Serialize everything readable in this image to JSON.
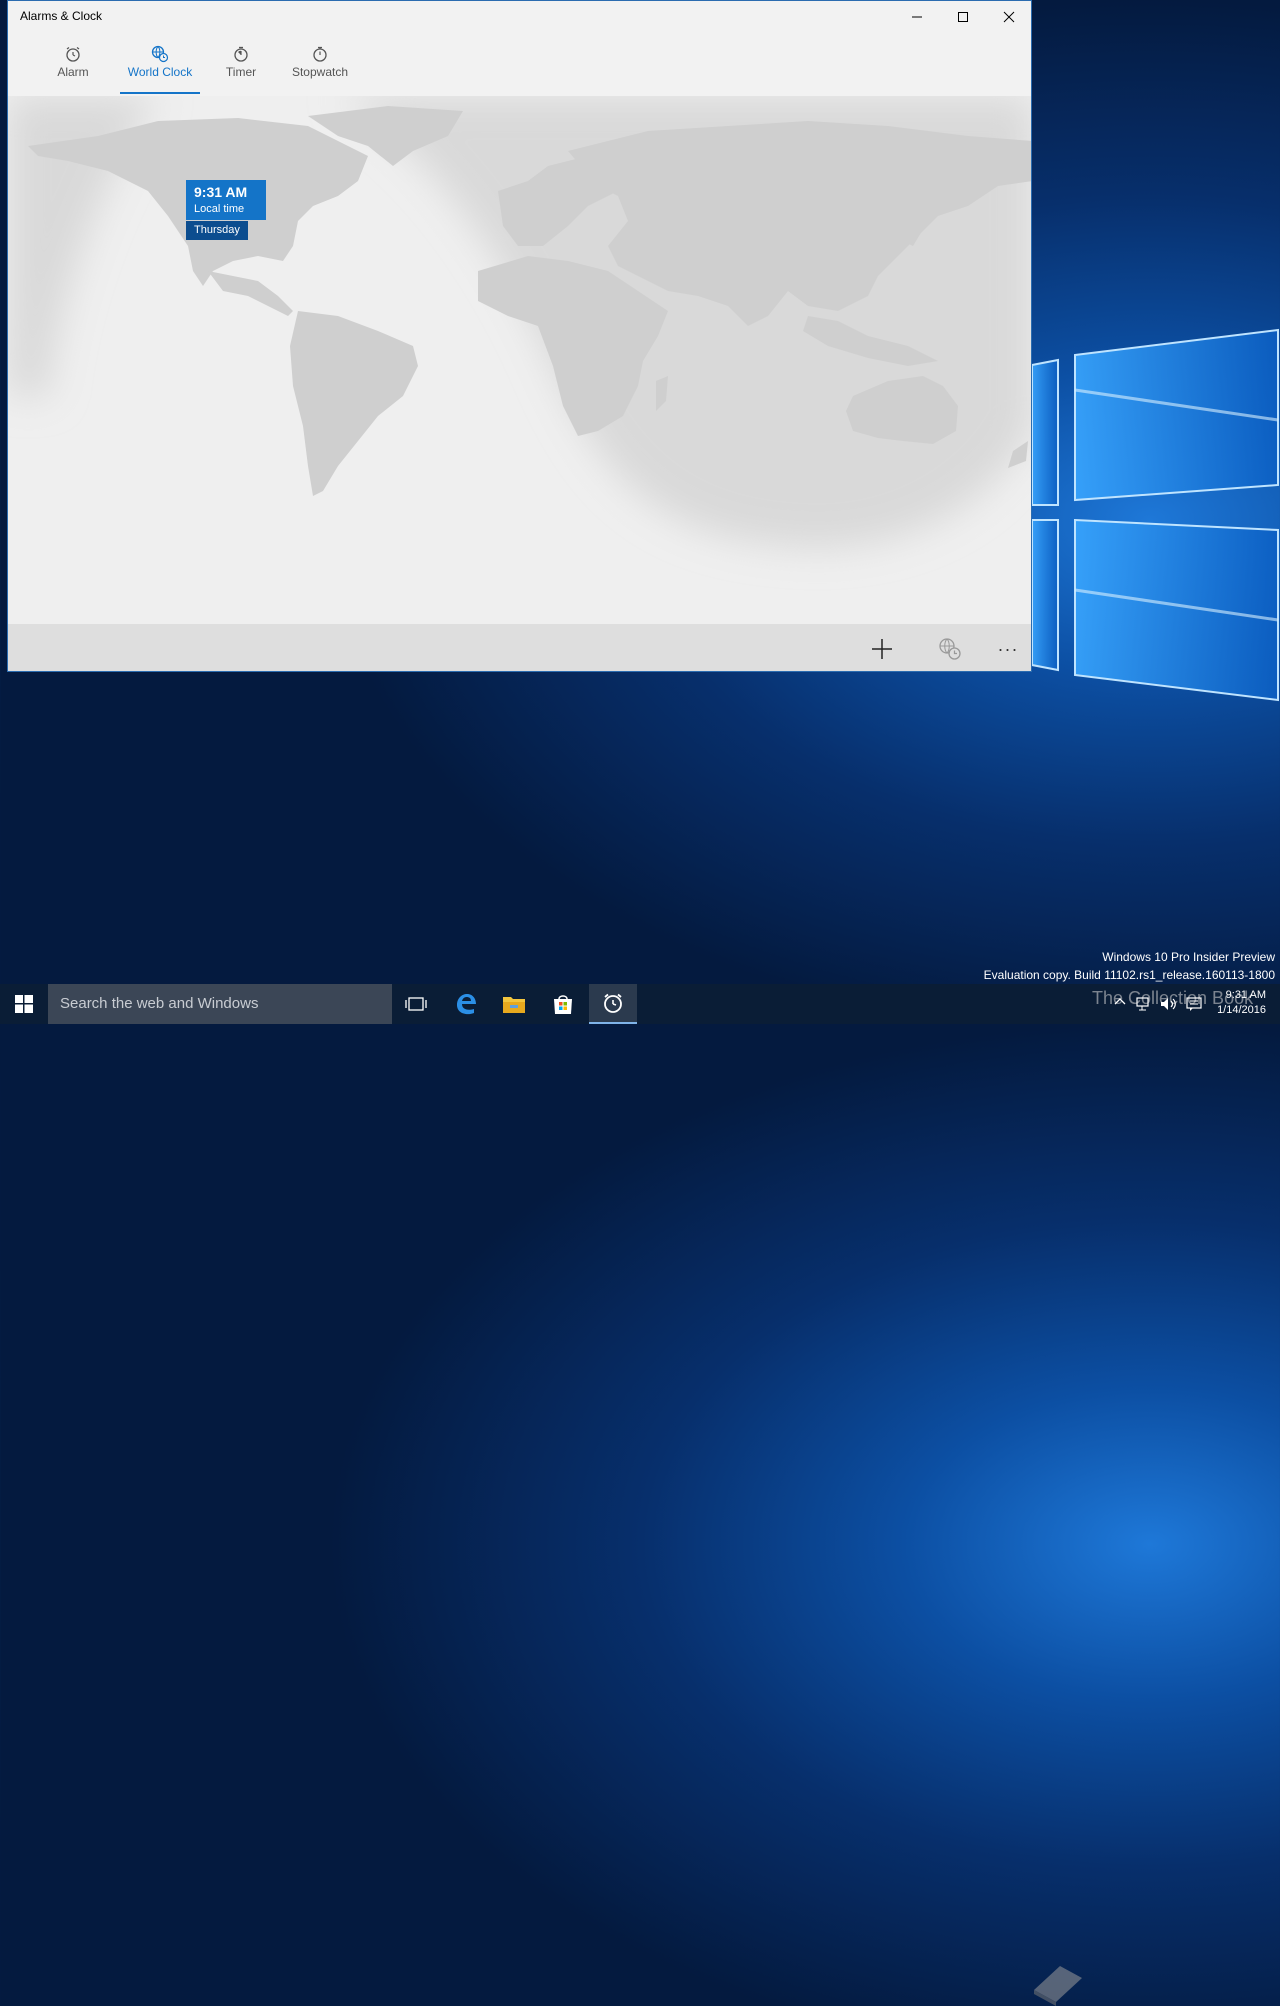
{
  "window": {
    "title": "Alarms & Clock"
  },
  "tabs": [
    {
      "label": "Alarm",
      "icon": "alarm-clock-icon"
    },
    {
      "label": "World Clock",
      "icon": "world-clock-icon",
      "active": true
    },
    {
      "label": "Timer",
      "icon": "timer-icon"
    },
    {
      "label": "Stopwatch",
      "icon": "stopwatch-icon"
    }
  ],
  "world_clock": {
    "time": "9:31 AM",
    "label": "Local time",
    "day": "Thursday"
  },
  "commandbar": {
    "add_icon": "plus-icon",
    "compare_icon": "compare-clock-icon",
    "more": "···"
  },
  "desktop": {
    "watermark_line1": "Windows 10 Pro Insider Preview",
    "watermark_line2": "Evaluation copy. Build 11102.rs1_release.160113-1800"
  },
  "taskbar": {
    "search_placeholder": "Search the web and Windows",
    "apps": [
      "task-view-icon",
      "edge-icon",
      "file-explorer-icon",
      "store-icon",
      "alarms-clock-icon"
    ],
    "clock_time": "9:31 AM",
    "clock_date": "1/14/2016"
  },
  "brand_watermark": "The Collection Book",
  "colors": {
    "accent": "#1474c8",
    "accent_dark": "#0c4d8f",
    "taskbar": "#0a1d36"
  }
}
